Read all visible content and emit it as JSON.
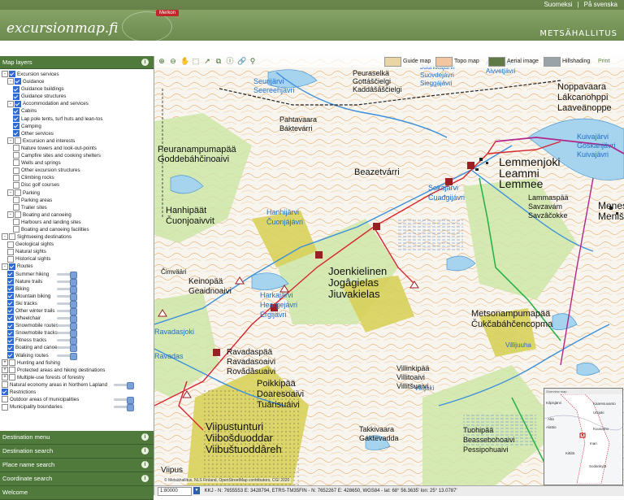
{
  "header": {
    "logo": "excursionmap.fi",
    "brand": "METSÄHALLITUS",
    "marker_label": "Merkon",
    "languages": [
      "Suomeksi",
      "|",
      "På svenska"
    ]
  },
  "sidebar": {
    "map_layers_title": "Map layers",
    "tree": [
      {
        "label": "Excursion services",
        "level": 0,
        "exp": "-",
        "checked": true
      },
      {
        "label": "Guidance",
        "level": 1,
        "exp": "-",
        "checked": true
      },
      {
        "label": "Guidance buildings",
        "level": 2,
        "checked": true
      },
      {
        "label": "Guidance structures",
        "level": 2,
        "checked": true
      },
      {
        "label": "Accommodation and services",
        "level": 1,
        "exp": "-",
        "checked": true
      },
      {
        "label": "Cabins",
        "level": 2,
        "checked": true
      },
      {
        "label": "Lap pole tents, turf huts and lean-tos",
        "level": 2,
        "checked": true
      },
      {
        "label": "Camping",
        "level": 2,
        "checked": true
      },
      {
        "label": "Other services",
        "level": 2,
        "checked": true
      },
      {
        "label": "Excursion and interests",
        "level": 1,
        "exp": "-",
        "checked": false
      },
      {
        "label": "Nature towers and look-out-points",
        "level": 2,
        "checked": false
      },
      {
        "label": "Campfire sites and cooking shelters",
        "level": 2,
        "checked": false
      },
      {
        "label": "Wells and springs",
        "level": 2,
        "checked": false
      },
      {
        "label": "Other excursion structures",
        "level": 2,
        "checked": false
      },
      {
        "label": "Climbing rocks",
        "level": 2,
        "checked": false
      },
      {
        "label": "Disc golf courses",
        "level": 2,
        "checked": false
      },
      {
        "label": "Parking",
        "level": 1,
        "exp": "-",
        "checked": false
      },
      {
        "label": "Parking areas",
        "level": 2,
        "checked": false
      },
      {
        "label": "Trailer sites",
        "level": 2,
        "checked": false
      },
      {
        "label": "Boating and canoeing",
        "level": 1,
        "exp": "-",
        "checked": false
      },
      {
        "label": "Harbours and landing sites",
        "level": 2,
        "checked": false
      },
      {
        "label": "Boating and canoeing facilities",
        "level": 2,
        "checked": false
      },
      {
        "label": "Sightseeing destinations",
        "level": 0,
        "exp": "-",
        "checked": false
      },
      {
        "label": "Geological sights",
        "level": 1,
        "checked": false
      },
      {
        "label": "Natural sights",
        "level": 1,
        "checked": false
      },
      {
        "label": "Historical sights",
        "level": 1,
        "checked": false
      },
      {
        "label": "Routes",
        "level": 0,
        "exp": "-",
        "checked": true
      },
      {
        "label": "Summer hiking",
        "level": 1,
        "checked": true,
        "slider": true
      },
      {
        "label": "Nature trails",
        "level": 1,
        "checked": true,
        "slider": true
      },
      {
        "label": "Biking",
        "level": 1,
        "checked": true,
        "slider": true
      },
      {
        "label": "Mountain biking",
        "level": 1,
        "checked": true,
        "slider": true
      },
      {
        "label": "Ski tracks",
        "level": 1,
        "checked": true,
        "slider": true
      },
      {
        "label": "Other winter trails",
        "level": 1,
        "checked": true,
        "slider": true
      },
      {
        "label": "Wheelchair",
        "level": 1,
        "checked": true,
        "slider": true
      },
      {
        "label": "Snowmobile routes",
        "level": 1,
        "checked": true,
        "slider": true
      },
      {
        "label": "Snowmobile tracks",
        "level": 1,
        "checked": true,
        "slider": true
      },
      {
        "label": "Fitness tracks",
        "level": 1,
        "checked": true,
        "slider": true
      },
      {
        "label": "Boating and canoe",
        "level": 1,
        "checked": true,
        "slider": true
      },
      {
        "label": "Walking routes",
        "level": 1,
        "checked": true,
        "slider": true
      },
      {
        "label": "Hunting and fishing",
        "level": 0,
        "exp": "+",
        "checked": false
      },
      {
        "label": "Protected areas and hiking destinations",
        "level": 0,
        "exp": "+",
        "checked": false
      },
      {
        "label": "Multiple-use forests of forestry",
        "level": 0,
        "exp": "+",
        "checked": false
      },
      {
        "label": "Natural economy areas in Northern Lapland",
        "level": 0,
        "checked": false,
        "slider": true
      },
      {
        "label": "Restrictions",
        "level": 0,
        "checked": true
      },
      {
        "label": "Outdoor areas of municipalities",
        "level": 0,
        "checked": false,
        "slider": true
      },
      {
        "label": "Municipality boundaries",
        "level": 0,
        "checked": false,
        "slider": true
      }
    ],
    "panels": [
      "Destination menu",
      "Destination search",
      "Place name search",
      "Coordinate search",
      "Welcome"
    ]
  },
  "toolbar": {
    "guide_map": "Guide map",
    "topo_map": "Topo map",
    "aerial_image": "Aerial image",
    "hillshading": "Hillshading",
    "print": "Print"
  },
  "map_labels": [
    "Juurkkajärvi",
    "Suovdejávri",
    "Sieggájávri",
    "Noppavaara",
    "Lákcanohppi",
    "Laaveänoppe",
    "Peuraselkä",
    "Gottáščielgi",
    "Kaddâšâščielgi",
    "Seurijärvi",
    "Seereehjävri",
    "Pahtavaara",
    "Báktevárri",
    "Peuranampumapää",
    "Goddebáhčinoaivi",
    "Beazetvárri",
    "Lemmenjoki",
    "Leammi",
    "Lemmee",
    "Sokajärvi",
    "Čuađgijávri",
    "Lammaspää",
    "Savzavám",
    "Savzâčokke",
    "Hanhipäät",
    "Čuonjoaivvit",
    "Hanhijärvi",
    "Čuonjájávri",
    "Keinopää",
    "Geaidnoaivi",
    "Joenkielinen",
    "Jogâgielas",
    "Jiuvakielas",
    "Harkajärvi",
    "Heargejávri",
    "Ergijävri",
    "Metsonampumapää",
    "Čukčabáhčencopma",
    "Ravadaspää",
    "Ravadasoaivi",
    "Rovâdâsuaivi",
    "Villinkipää",
    "Villitoaivi",
    "Villitšuaivi",
    "Poikkipää",
    "Doaresoaivi",
    "Tuárisuáivi",
    "Viipustunturi",
    "Viibošduoddar",
    "Viibuštuoddâreh",
    "Takkivaara",
    "Gáktevadda",
    "Tuohipää",
    "Beassebohoaivi",
    "Pessipohuaivi",
    "Menes",
    "Meniš",
    "Kuivajärvi",
    "Goskanjävri",
    "Kuivajävri",
    "Ravadasjoki",
    "Villijoki",
    "Villijuuha",
    "Ravadas",
    "Čimvääri",
    "Viipus",
    "Aivvetjävri",
    "Aivvetjävri"
  ],
  "inset": {
    "title": "Overview map",
    "labels": [
      "Kilpisjärvi",
      "Kaaresuvanto",
      "Alta",
      "Alattio",
      "Kuusamo",
      "Sodankylä",
      "Kittilä",
      "Inari",
      "Utsjoki"
    ]
  },
  "status": {
    "scale": "1:80000",
    "coords": "KKJ - N: 7655553 E: 3428794, ETRS-TM35FIN - N: 7652267 E: 428650, WGS84 - lat: 68° 56.3635' lon: 25° 13.0787'"
  },
  "copyright": "© Metsähallitus, NLS Finland, OpenStreetMap contributors, CGI 2020"
}
